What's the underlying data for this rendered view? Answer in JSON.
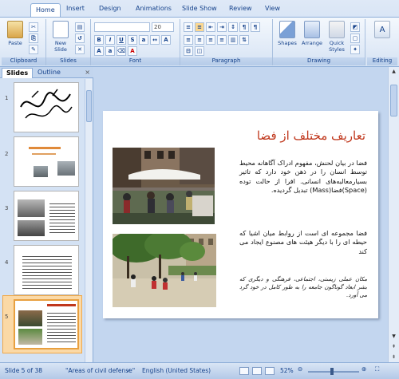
{
  "ribbon": {
    "tabs": [
      "Home",
      "Insert",
      "Design",
      "Animations",
      "Slide Show",
      "Review",
      "View"
    ],
    "active_tab": "Home",
    "clipboard": {
      "paste": "Paste",
      "label": "Clipboard"
    },
    "slides": {
      "new_slide": "New Slide",
      "label": "Slides"
    },
    "font": {
      "size": "20",
      "label": "Font"
    },
    "paragraph": {
      "label": "Paragraph"
    },
    "drawing": {
      "shapes": "Shapes",
      "arrange": "Arrange",
      "quick_styles": "Quick Styles",
      "label": "Drawing"
    },
    "editing": {
      "label": "Editing"
    }
  },
  "pane": {
    "tabs": [
      "Slides",
      "Outline"
    ],
    "active_tab": "Slides",
    "close": "×",
    "thumb_numbers": [
      "1",
      "2",
      "3",
      "4",
      "5"
    ]
  },
  "slide": {
    "title": "تعاریف مختلف از فضا",
    "paragraph1": "فضا در بیان لحنش، مفهوم ادراک آگاهانه محیط توسط انسان را در ذهن خود دارد که تاثیر بسیارمعالبه‌‌های انسانی. افرا از حالت توده (Space)فضا(Mass) تبدیل گردیده.",
    "paragraph2": "فضا مجموعه ای است از روابط میان اشیا که حیطه ای را با دیگر هیئت های مصنوع ایجاد می کند",
    "paragraph3": "مکان عملی زیستی، اجتماعی، فرهنگی و دیگری که بشر ابعاد گوناگون جامعه را به طور کامل در خود گرد می آورد."
  },
  "status": {
    "slide": "Slide 5 of 38",
    "theme": "\"Areas of civil defense\"",
    "language": "English (United States)",
    "zoom": "52%"
  },
  "colors": {
    "title": "#c0371c",
    "accent": "#f0a848"
  }
}
